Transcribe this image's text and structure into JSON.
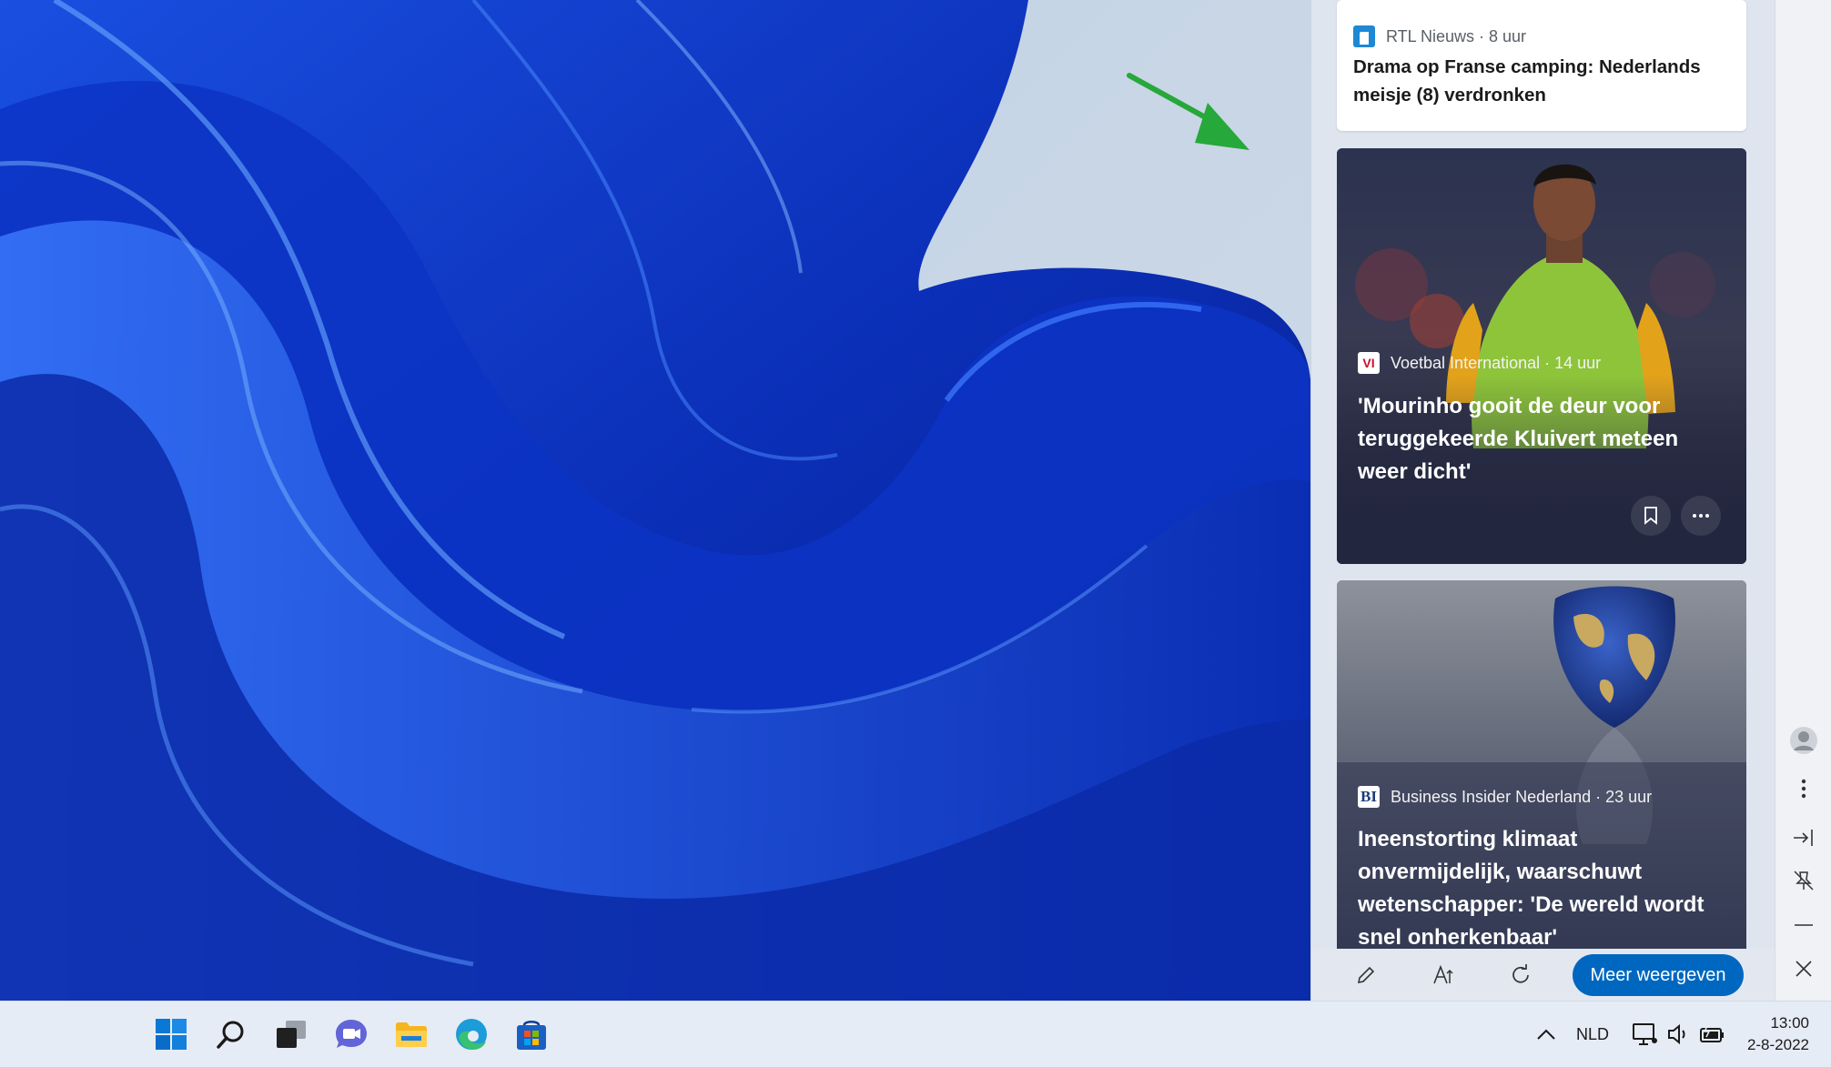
{
  "widgets": {
    "card_1": {
      "source": "RTL Nieuws · 8 uur",
      "title": "Drama op Franse camping: Nederlands meisje (8) verdronken"
    },
    "card_2": {
      "source": "Voetbal International · 14 uur",
      "title": "'Mourinho gooit de deur voor teruggekeerde Kluivert meteen weer dicht'",
      "logo": "VI"
    },
    "card_3": {
      "source": "Business Insider Nederland · 23 uur",
      "title": "Ineenstorting klimaat onvermijdelijk, waarschuwt wetenschapper: 'De wereld wordt snel onherkenbaar'",
      "logo": "BI"
    },
    "bar": {
      "more_label": "Meer weergeven"
    }
  },
  "taskbar": {
    "language": "NLD",
    "time": "13:00",
    "date": "2-8-2022"
  },
  "colors": {
    "accent": "#0067c0",
    "arrow": "#27a83a"
  }
}
